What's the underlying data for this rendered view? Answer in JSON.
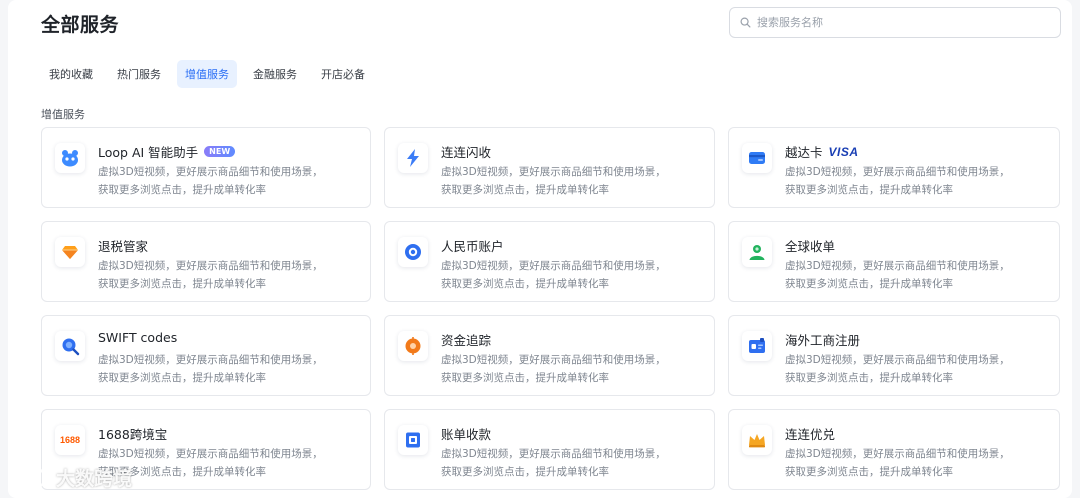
{
  "page": {
    "title": "全部服务"
  },
  "search": {
    "placeholder": "搜索服务名称"
  },
  "tabs": [
    {
      "label": "我的收藏",
      "active": false
    },
    {
      "label": "热门服务",
      "active": false
    },
    {
      "label": "增值服务",
      "active": true
    },
    {
      "label": "金融服务",
      "active": false
    },
    {
      "label": "开店必备",
      "active": false
    }
  ],
  "section": {
    "title": "增值服务"
  },
  "services": [
    {
      "title": "Loop AI 智能助手",
      "badge": "NEW",
      "icon": "robot-icon",
      "desc1": "虚拟3D短视频，更好展示商品细节和使用场景，",
      "desc2": "获取更多浏览点击，提升成单转化率"
    },
    {
      "title": "连连闪收",
      "icon": "lightning-icon",
      "desc1": "虚拟3D短视频，更好展示商品细节和使用场景，",
      "desc2": "获取更多浏览点击，提升成单转化率"
    },
    {
      "title": "越达卡",
      "logo": "VISA",
      "icon": "card-icon",
      "desc1": "虚拟3D短视频，更好展示商品细节和使用场景，",
      "desc2": "获取更多浏览点击，提升成单转化率"
    },
    {
      "title": "退税管家",
      "icon": "diamond-icon",
      "desc1": "虚拟3D短视频，更好展示商品细节和使用场景，",
      "desc2": "获取更多浏览点击，提升成单转化率"
    },
    {
      "title": "人民币账户",
      "icon": "account-icon",
      "desc1": "虚拟3D短视频，更好展示商品细节和使用场景，",
      "desc2": "获取更多浏览点击，提升成单转化率"
    },
    {
      "title": "全球收单",
      "icon": "globe-user-icon",
      "desc1": "虚拟3D短视频，更好展示商品细节和使用场景，",
      "desc2": "获取更多浏览点击，提升成单转化率"
    },
    {
      "title": "SWIFT codes",
      "icon": "magnifier-icon",
      "desc1": "虚拟3D短视频，更好展示商品细节和使用场景，",
      "desc2": "获取更多浏览点击，提升成单转化率"
    },
    {
      "title": "资金追踪",
      "icon": "target-icon",
      "desc1": "虚拟3D短视频，更好展示商品细节和使用场景，",
      "desc2": "获取更多浏览点击，提升成单转化率"
    },
    {
      "title": "海外工商注册",
      "icon": "id-card-icon",
      "desc1": "虚拟3D短视频，更好展示商品细节和使用场景，",
      "desc2": "获取更多浏览点击，提升成单转化率"
    },
    {
      "title": "1688跨境宝",
      "icon": "1688-logo-icon",
      "iconText": "1688",
      "desc1": "虚拟3D短视频，更好展示商品细节和使用场景，",
      "desc2": "获取更多浏览点击，提升成单转化率"
    },
    {
      "title": "账单收款",
      "icon": "bill-icon",
      "desc1": "虚拟3D短视频，更好展示商品细节和使用场景，",
      "desc2": "获取更多浏览点击，提升成单转化率"
    },
    {
      "title": "连连优兑",
      "icon": "crown-icon",
      "desc1": "虚拟3D短视频，更好展示商品细节和使用场景，",
      "desc2": "获取更多浏览点击，提升成单转化率"
    }
  ],
  "watermark": {
    "text": "大数跨境"
  },
  "colors": {
    "accent": "#2a6ef5",
    "tab_active_bg": "#e8f1ff",
    "badge": "#7c83fb"
  }
}
